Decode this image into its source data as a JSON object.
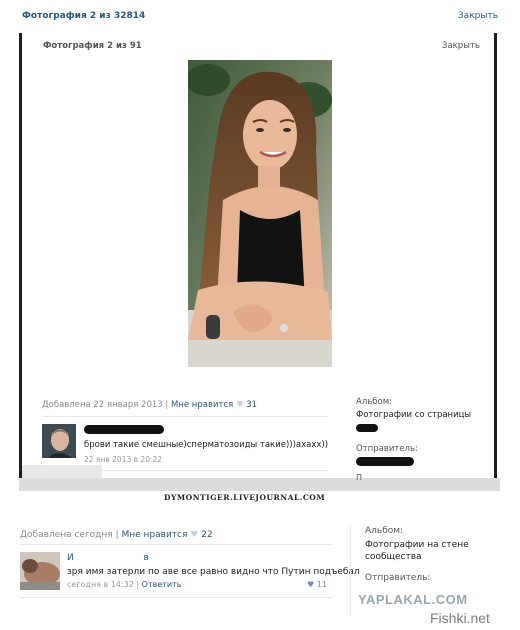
{
  "outer": {
    "title": "Фотография 2 из 32814",
    "close": "Закрыть"
  },
  "inner": {
    "title": "Фотография 2 из 91",
    "close": "Закрыть",
    "added": "Добавлена 22 января 2013",
    "like_label": "Мне нравится",
    "like_count": "31",
    "comment": {
      "text": "брови такие смешные)сперматозоиды такие)))ахахх))",
      "time": "22 янв 2013 в 20:22"
    },
    "album_label": "Альбом:",
    "album_value": "Фотографии со страницы",
    "sender_label": "Отправитель:",
    "cut_text": "П"
  },
  "watermark_lj": "DYMONTIGER.LIVEJOURNAL.COM",
  "lower": {
    "added": "Добавлена сегодня",
    "like_label": "Мне нравится",
    "like_count": "22",
    "comment": {
      "name_first": "И",
      "name_last": "в",
      "text": "зря имя затерли по аве все равно видно что Путин подъебал",
      "time": "сегодня в 14:32",
      "reply": "Ответить",
      "likes": "11"
    },
    "album_label": "Альбом:",
    "album_value": "Фотографии на стене сообщества",
    "sender_label": "Отправитель:"
  },
  "watermarks": {
    "yaplakal": "YAPLAKAL.COM",
    "fishki": "Fishki.net"
  },
  "icons": {
    "heart": "heart-icon"
  },
  "colors": {
    "link": "#2b587a",
    "muted": "#8a8a8a",
    "heart": "#c6d3e0"
  }
}
